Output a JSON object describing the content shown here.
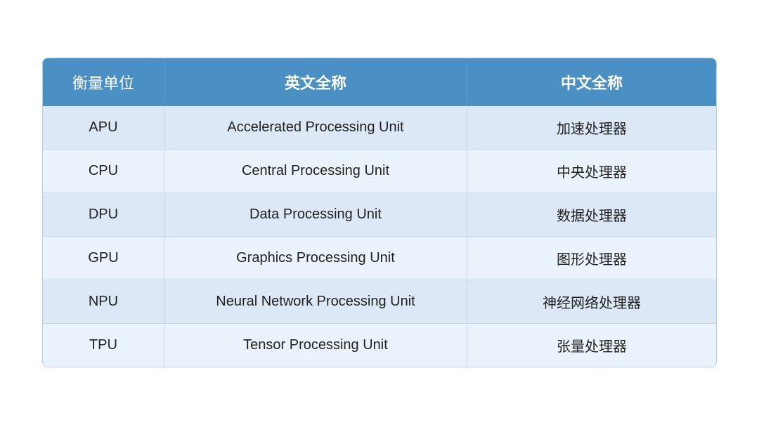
{
  "table": {
    "headers": [
      {
        "label": "衡量单位",
        "key": "header-abbr"
      },
      {
        "label": "英文全称",
        "key": "header-en"
      },
      {
        "label": "中文全称",
        "key": "header-zh"
      }
    ],
    "rows": [
      {
        "abbr": "APU",
        "en": "Accelerated Processing Unit",
        "zh": "加速处理器"
      },
      {
        "abbr": "CPU",
        "en": "Central Processing Unit",
        "zh": "中央处理器"
      },
      {
        "abbr": "DPU",
        "en": "Data Processing Unit",
        "zh": "数据处理器"
      },
      {
        "abbr": "GPU",
        "en": "Graphics Processing Unit",
        "zh": "图形处理器"
      },
      {
        "abbr": "NPU",
        "en": "Neural Network Processing Unit",
        "zh": "神经网络处理器"
      },
      {
        "abbr": "TPU",
        "en": "Tensor Processing Unit",
        "zh": "张量处理器"
      }
    ]
  }
}
